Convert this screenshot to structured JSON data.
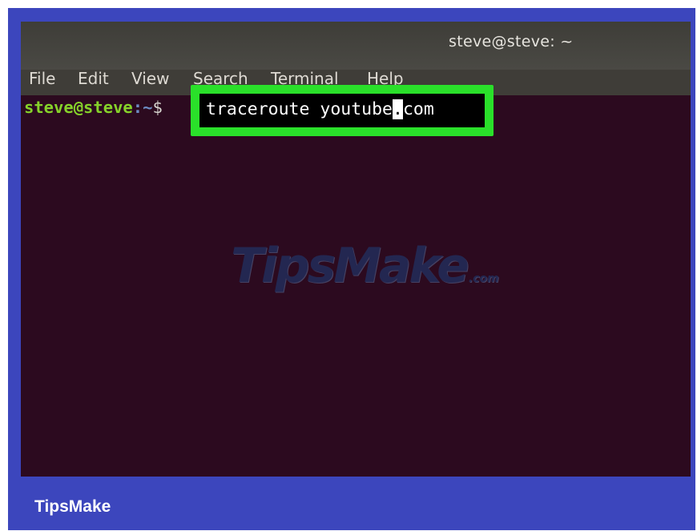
{
  "window": {
    "title": "steve@steve: ~"
  },
  "menubar": {
    "items": [
      "File",
      "Edit",
      "View",
      "Search",
      "Terminal",
      "Help"
    ]
  },
  "terminal": {
    "prompt_user": "steve@steve",
    "prompt_path": ":~",
    "prompt_dollar": "$",
    "command_before_cursor": "traceroute youtube",
    "command_cursor_char": ".",
    "command_after_cursor": "com"
  },
  "watermark": {
    "text": "TipsMake",
    "suffix": ".com"
  },
  "footer": {
    "brand": "TipsMake"
  },
  "colors": {
    "frame_background": "#3c46bd",
    "terminal_background": "#2c0a1f",
    "highlight_box": "#2ae02a",
    "prompt_user": "#86d22a",
    "prompt_path": "#6d8cc4"
  }
}
